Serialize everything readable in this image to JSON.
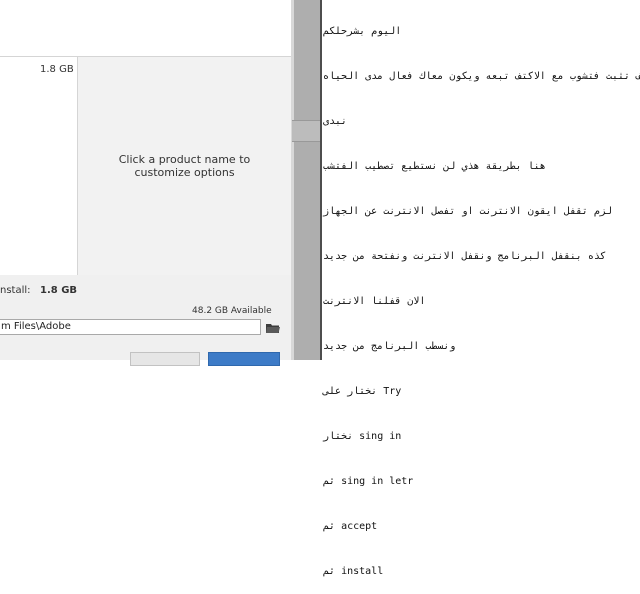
{
  "installer": {
    "item_size": "1.8 GB",
    "detail_message": "Click a product name to customize options",
    "install_label": "nstall:",
    "install_size": "1.8 GB",
    "available": "48.2 GB Available",
    "path_value": "m Files\\Adobe",
    "folder_icon": "folder-icon"
  },
  "notepad": {
    "lines": [
      "اليوم بشرحلكم",
      "كيف تثبت فتشوب مع الاكتف تبعه ويكون معاك فعال مدى الحياه",
      "نبدى",
      "هنا بطريقة هذي لن نستطيع تصطيب الفتشب",
      "لزم تقفل ايقون الانترنت او تفصل الانترنت عن الجهاز",
      "كذه بنقفل البرنامج ونقفل الانترنت ونفتحة من جديد",
      "الان قفلنا الانترنت",
      "ونسطب البرنامج من جديد",
      "نختار على Try",
      "نختار sing in",
      "ثم sing in letr",
      "ثم accept",
      "ثم install"
    ]
  }
}
